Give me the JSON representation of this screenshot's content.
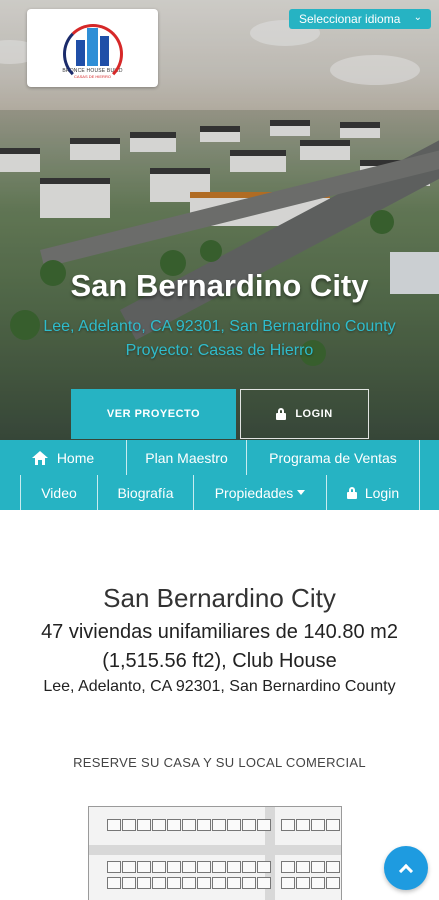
{
  "brand": {
    "logo_text": "BRONCE HOUSE BUILD",
    "logo_subtext": "CASAS DE HIERRO"
  },
  "language": {
    "label": "Seleccionar idioma",
    "icon": "chevron-down-icon"
  },
  "hero": {
    "title": "San Bernardino City",
    "address": "Lee, Adelanto, CA 92301, San Bernardino County",
    "project": "Proyecto: Casas de Hierro",
    "view_button": "VER PROYECTO",
    "login_button": "LOGIN"
  },
  "nav": {
    "home": "Home",
    "master_plan": "Plan Maestro",
    "sales_program": "Programa de Ventas",
    "video": "Video",
    "biography": "Biografía",
    "properties": "Propiedades",
    "login": "Login"
  },
  "content": {
    "title": "San Bernardino City",
    "line1": "47 viviendas unifamiliares de 140.80 m2",
    "line2": "(1,515.56 ft2), Club House",
    "line3": "Lee, Adelanto, CA 92301, San Bernardino County",
    "reserve": "RESERVE SU CASA Y SU LOCAL COMERCIAL"
  },
  "colors": {
    "accent": "#26b3c3",
    "scroll_button": "#1e9be0"
  }
}
